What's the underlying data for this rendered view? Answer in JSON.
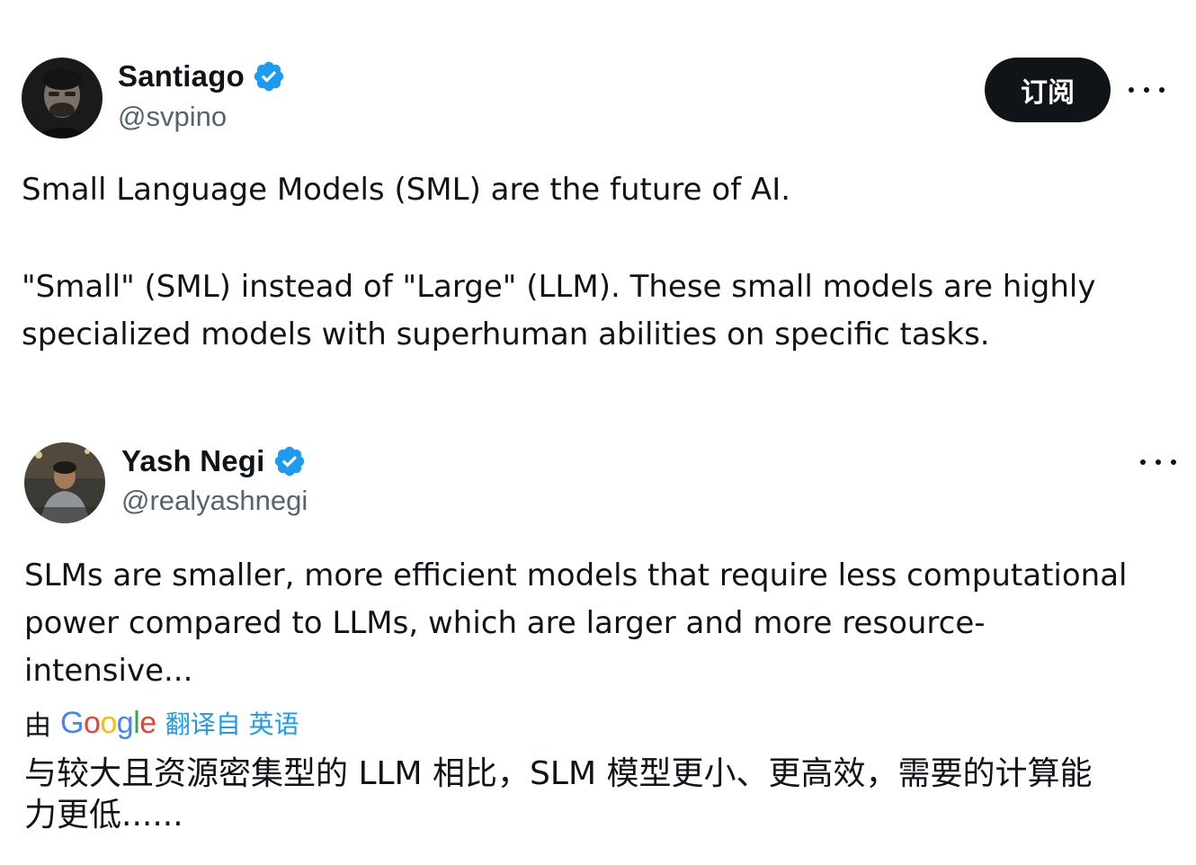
{
  "tweets": [
    {
      "author": {
        "name": "Santiago",
        "handle": "@svpino",
        "verified": true
      },
      "subscribe_label": "订阅",
      "body": [
        "Small Language Models (SML) are the future of AI.",
        "\"Small\" (SML) instead of \"Large\" (LLM). These small models are highly",
        "specialized models with superhuman abilities on specific tasks."
      ]
    },
    {
      "author": {
        "name": "Yash Negi",
        "handle": "@realyashnegi",
        "verified": true
      },
      "body": [
        "SLMs are smaller, more efficient models that require less computational",
        "power compared to LLMs, which are larger and more resource-",
        "intensive..."
      ],
      "translation": {
        "by": "由",
        "provider": "Google",
        "link": "翻译自 英语",
        "text": [
          "与较大且资源密集型的 LLM 相比，SLM 模型更小、更高效，需要的计算能",
          "力更低......"
        ]
      }
    }
  ],
  "icons": {
    "verified": "verified-badge-icon",
    "more": "more-options-icon"
  },
  "colors": {
    "text": "#0f1419",
    "secondary": "#536471",
    "verified": "#1d9bf0",
    "link": "#1d9bf0",
    "button": "#0f1419"
  }
}
